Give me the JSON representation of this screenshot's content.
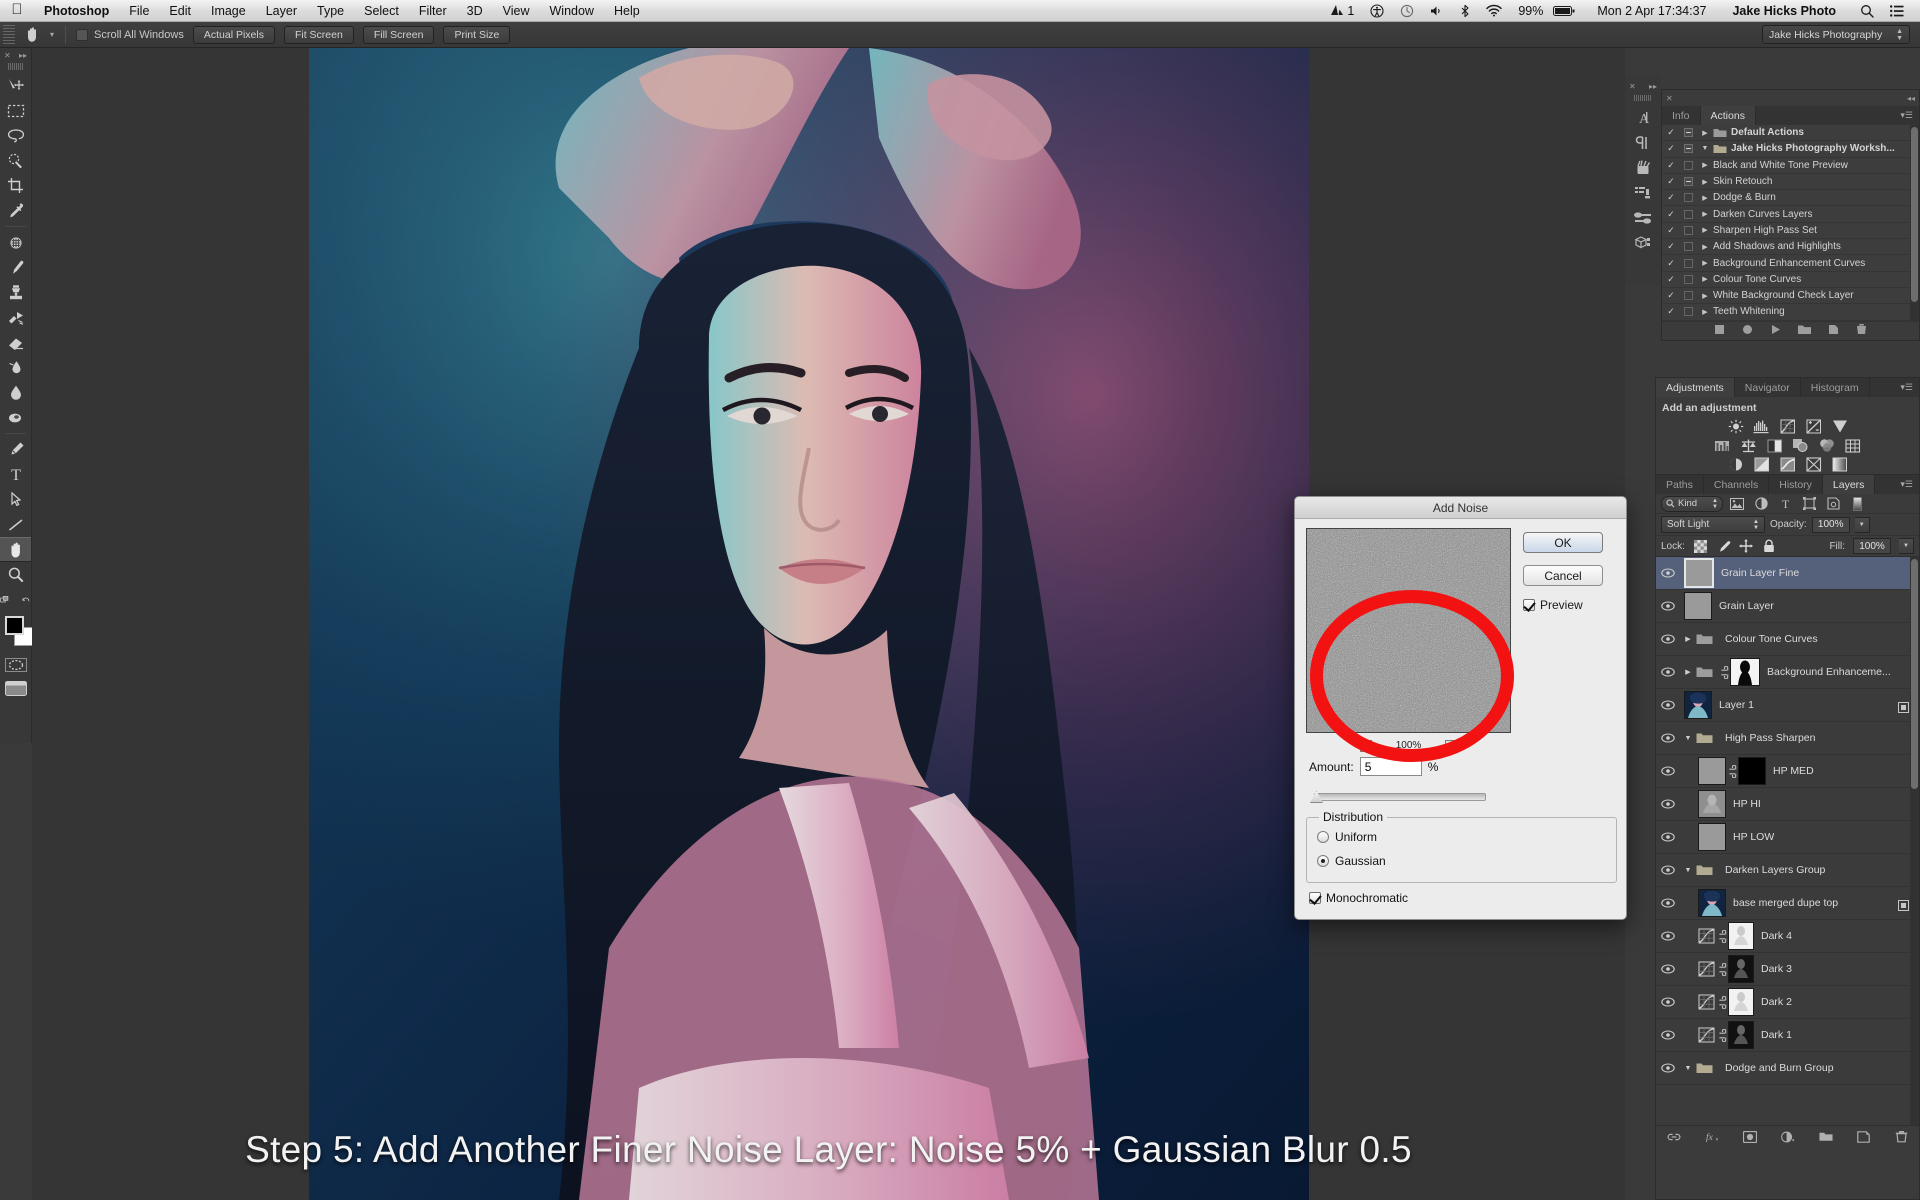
{
  "menubar": {
    "apple_icon": "apple-logo",
    "items": [
      "Photoshop",
      "File",
      "Edit",
      "Image",
      "Layer",
      "Type",
      "Select",
      "Filter",
      "3D",
      "View",
      "Window",
      "Help"
    ],
    "status": {
      "adobe_badge": "1",
      "accessibility_icon": "accessibility-icon",
      "timemachine_icon": "clock-icon",
      "volume_icon": "speaker-icon",
      "bluetooth_icon": "bluetooth-icon",
      "wifi_icon": "wifi-icon",
      "battery_percent": "99%",
      "battery_icon": "battery-icon",
      "datetime": "Mon 2 Apr  17:34:37",
      "user": "Jake Hicks Photo",
      "search_icon": "search-icon",
      "notifications_icon": "list-icon"
    }
  },
  "optionsbar": {
    "tool_icon": "hand-tool-icon",
    "scroll_all_windows": "Scroll All Windows",
    "buttons": [
      "Actual Pixels",
      "Fit Screen",
      "Fill Screen",
      "Print Size"
    ],
    "workspace": "Jake Hicks Photography"
  },
  "toolbox": {
    "tools": [
      {
        "name": "move-tool"
      },
      {
        "name": "rectangular-marquee-tool"
      },
      {
        "name": "lasso-tool"
      },
      {
        "name": "quick-selection-tool"
      },
      {
        "name": "crop-tool"
      },
      {
        "name": "eyedropper-tool"
      },
      {
        "name": "spot-healing-brush-tool"
      },
      {
        "name": "brush-tool"
      },
      {
        "name": "clone-stamp-tool"
      },
      {
        "name": "history-brush-tool"
      },
      {
        "name": "eraser-tool"
      },
      {
        "name": "gradient-tool"
      },
      {
        "name": "blur-tool"
      },
      {
        "name": "dodge-tool"
      },
      {
        "name": "pen-tool"
      },
      {
        "name": "type-tool"
      },
      {
        "name": "path-selection-tool"
      },
      {
        "name": "line-tool"
      },
      {
        "name": "hand-tool",
        "selected": true
      },
      {
        "name": "zoom-tool"
      }
    ],
    "foreground_color": "#000000",
    "background_color": "#ffffff"
  },
  "canvas": {
    "caption": "Step 5: Add Another Finer Noise Layer: Noise 5% + Gaussian Blur 0.5"
  },
  "icon_column": [
    {
      "name": "character-panel-icon"
    },
    {
      "name": "paragraph-panel-icon"
    },
    {
      "name": "brush-presets-icon"
    },
    {
      "name": "tool-presets-icon"
    },
    {
      "name": "adjustments-shortcut-icon"
    },
    {
      "name": "3d-panel-icon"
    }
  ],
  "actions_panel": {
    "tabs": [
      "Info",
      "Actions"
    ],
    "active_tab": "Actions",
    "rows": [
      {
        "label": "Default Actions",
        "checked": true,
        "dialog_box": true,
        "expanded": false,
        "type": "set"
      },
      {
        "label": "Jake Hicks Photography Worksh...",
        "checked": true,
        "dialog_box": true,
        "expanded": true,
        "type": "set"
      },
      {
        "label": "Black and White Tone Preview",
        "checked": true,
        "dialog_box": false,
        "type": "action"
      },
      {
        "label": "Skin Retouch",
        "checked": true,
        "dialog_box": true,
        "type": "action"
      },
      {
        "label": "Dodge & Burn",
        "checked": true,
        "dialog_box": false,
        "type": "action"
      },
      {
        "label": "Darken Curves Layers",
        "checked": true,
        "dialog_box": false,
        "type": "action"
      },
      {
        "label": "Sharpen High Pass Set",
        "checked": true,
        "dialog_box": false,
        "type": "action"
      },
      {
        "label": "Add Shadows and Highlights",
        "checked": true,
        "dialog_box": false,
        "type": "action"
      },
      {
        "label": "Background Enhancement Curves",
        "checked": true,
        "dialog_box": false,
        "type": "action"
      },
      {
        "label": "Colour Tone Curves",
        "checked": true,
        "dialog_box": false,
        "type": "action"
      },
      {
        "label": "White Background Check Layer",
        "checked": true,
        "dialog_box": false,
        "type": "action"
      },
      {
        "label": "Teeth Whitening",
        "checked": true,
        "dialog_box": false,
        "type": "action"
      }
    ],
    "footer_icons": [
      "stop-icon",
      "record-icon",
      "play-icon",
      "new-set-icon",
      "new-action-icon",
      "delete-icon"
    ]
  },
  "adjustments_panel": {
    "tabs": [
      "Adjustments",
      "Navigator",
      "Histogram"
    ],
    "active_tab": "Adjustments",
    "title": "Add an adjustment",
    "row1": [
      "brightness-contrast-icon",
      "levels-icon",
      "curves-icon",
      "exposure-icon",
      "vibrance-icon"
    ],
    "row2": [
      "hue-saturation-icon",
      "color-balance-icon",
      "black-white-icon",
      "photo-filter-icon",
      "channel-mixer-icon",
      "color-lookup-icon"
    ],
    "row3": [
      "invert-icon",
      "posterize-icon",
      "threshold-icon",
      "selective-color-icon",
      "gradient-map-icon"
    ]
  },
  "layers_panel": {
    "tabs": [
      "Paths",
      "Channels",
      "History",
      "Layers"
    ],
    "active_tab": "Layers",
    "filter_kind": "Kind",
    "filter_icons": [
      "filter-pixel-icon",
      "filter-adjustment-icon",
      "filter-type-icon",
      "filter-shape-icon",
      "filter-smart-icon",
      "filter-toggle-icon"
    ],
    "blend_mode": "Soft Light",
    "opacity_label": "Opacity:",
    "opacity_value": "100%",
    "lock_label": "Lock:",
    "lock_icons": [
      "lock-transparency-icon",
      "lock-image-icon",
      "lock-position-icon",
      "lock-all-icon"
    ],
    "fill_label": "Fill:",
    "fill_value": "100%",
    "layers": [
      {
        "name": "Grain Layer Fine",
        "visible": true,
        "selected": true,
        "indent": 0,
        "kind": "pixel",
        "thumb": "#9a9a9a"
      },
      {
        "name": "Grain Layer",
        "visible": true,
        "selected": false,
        "indent": 0,
        "kind": "pixel",
        "thumb": "#9a9a9a"
      },
      {
        "name": "Colour Tone Curves",
        "visible": true,
        "selected": false,
        "indent": 0,
        "kind": "group",
        "expanded": false
      },
      {
        "name": "Background Enhanceme...",
        "visible": true,
        "selected": false,
        "indent": 0,
        "kind": "group-masked",
        "expanded": false
      },
      {
        "name": "Layer 1",
        "visible": true,
        "selected": false,
        "indent": 0,
        "kind": "smart",
        "thumb": "photo"
      },
      {
        "name": "High Pass Sharpen",
        "visible": true,
        "selected": false,
        "indent": 0,
        "kind": "group",
        "expanded": true
      },
      {
        "name": "HP MED",
        "visible": true,
        "selected": false,
        "indent": 1,
        "kind": "pixel-masked",
        "thumb": "#9a9a9a",
        "mask": "#000000"
      },
      {
        "name": "HP HI",
        "visible": true,
        "selected": false,
        "indent": 1,
        "kind": "pixel",
        "thumb": "gray-detail"
      },
      {
        "name": "HP LOW",
        "visible": true,
        "selected": false,
        "indent": 1,
        "kind": "pixel",
        "thumb": "#9a9a9a"
      },
      {
        "name": "Darken Layers Group",
        "visible": true,
        "selected": false,
        "indent": 0,
        "kind": "group",
        "expanded": true
      },
      {
        "name": "base merged dupe top",
        "visible": true,
        "selected": false,
        "indent": 1,
        "kind": "smart",
        "thumb": "photo"
      },
      {
        "name": "Dark 4",
        "visible": true,
        "selected": false,
        "indent": 1,
        "kind": "curves",
        "mask": "light"
      },
      {
        "name": "Dark 3",
        "visible": true,
        "selected": false,
        "indent": 1,
        "kind": "curves",
        "mask": "dark"
      },
      {
        "name": "Dark 2",
        "visible": true,
        "selected": false,
        "indent": 1,
        "kind": "curves",
        "mask": "light"
      },
      {
        "name": "Dark 1",
        "visible": true,
        "selected": false,
        "indent": 1,
        "kind": "curves",
        "mask": "dark"
      },
      {
        "name": "Dodge and Burn Group",
        "visible": true,
        "selected": false,
        "indent": 0,
        "kind": "group",
        "expanded": true
      }
    ],
    "footer_icons": [
      "link-layers-icon",
      "layer-style-fx-icon",
      "add-mask-icon",
      "new-adjustment-icon",
      "new-group-icon",
      "new-layer-icon",
      "delete-layer-icon"
    ]
  },
  "add_noise_dialog": {
    "title": "Add Noise",
    "ok_label": "OK",
    "cancel_label": "Cancel",
    "preview_label": "Preview",
    "preview_checked": true,
    "zoom_level": "100%",
    "zoom_out_icon": "minus-icon",
    "zoom_in_icon": "plus-icon",
    "amount_label": "Amount:",
    "amount_value": "5",
    "amount_unit": "%",
    "distribution_label": "Distribution",
    "uniform_label": "Uniform",
    "gaussian_label": "Gaussian",
    "distribution_selected": "Gaussian",
    "monochromatic_label": "Monochromatic",
    "monochromatic_checked": true,
    "highlight_color": "#f21212"
  }
}
